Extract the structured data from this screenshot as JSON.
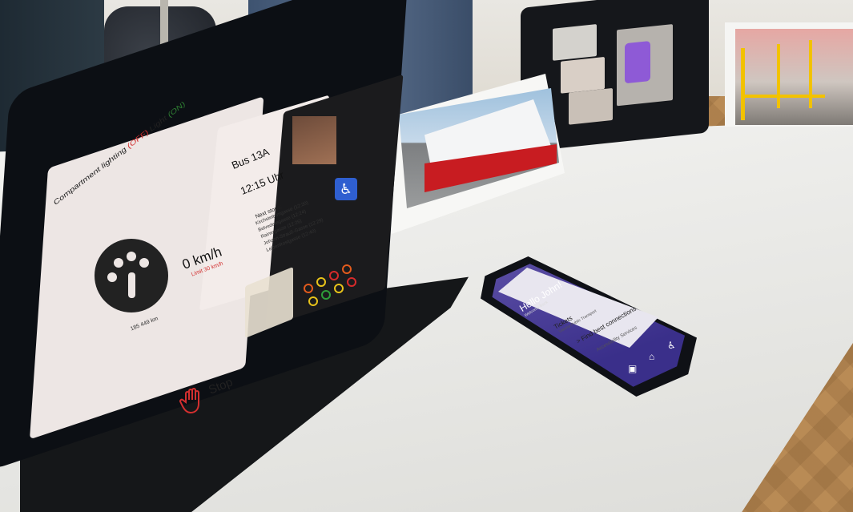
{
  "scene": "Transit app prototypes displayed on a table",
  "tablet": {
    "topbar_prefix": "Compartment lighting",
    "topbar_off": "(OFF)",
    "topbar_light": "Light",
    "topbar_on": "(ON)",
    "speed": "0 km/h",
    "limit": "Limit 30 km/h",
    "odometer": "185 449 km",
    "stop_label": "Stop",
    "bus_title": "Bus 13A",
    "bus_time": "12:15 Uhr",
    "stops_header": "Next stops:",
    "stops": [
      "Kirchstetterngasse (12:20)",
      "Belvederegasse (12:24)",
      "Rainergasse (12:26)",
      "Johann-Strauß-Gasse (12:29)",
      "Leibenfrostgasse (12:40)"
    ]
  },
  "phone": {
    "greeting": "Hello John!",
    "welcome": "Welcome Back",
    "items": [
      {
        "label": "Tickets",
        "sub": "Vienna Public Transport"
      },
      {
        "label": "> Find best connections",
        "sub": ""
      },
      {
        "label": "Accessibility Services",
        "sub": ""
      }
    ]
  },
  "colors": {
    "off": "#d32f2f",
    "on": "#2e7d32",
    "phone_bg": "#3a2f8a",
    "bus_red": "#c81c21",
    "wheelchair": "#2f5fd0"
  },
  "icons": [
    "speedometer-icon",
    "hand-stop-icon",
    "wheelchair-icon",
    "home-icon",
    "accessibility-icon",
    "ticket-icon"
  ]
}
